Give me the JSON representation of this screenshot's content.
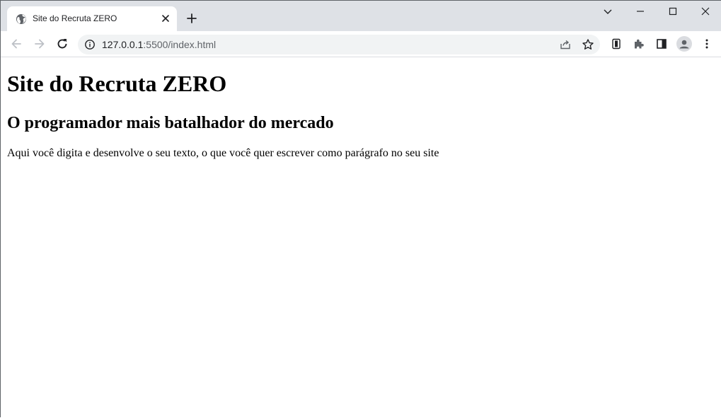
{
  "browser": {
    "tab": {
      "title": "Site do Recruta ZERO",
      "favicon": "globe-icon"
    },
    "address_bar": {
      "url_host": "127.0.0.1",
      "url_rest": ":5500/index.html"
    },
    "icons": {
      "back": "arrow-left-icon",
      "forward": "arrow-right-icon",
      "reload": "reload-icon",
      "site_info": "info-icon",
      "share": "share-icon",
      "bookmark": "star-icon",
      "extension_1": "extension-icon",
      "extensions": "puzzle-icon",
      "side_panel": "side-panel-icon",
      "profile": "avatar-icon",
      "menu": "more-vert-icon",
      "tab_search": "chevron-down-icon",
      "minimize": "minimize-icon",
      "maximize": "maximize-icon",
      "close": "close-icon",
      "new_tab": "plus-icon"
    }
  },
  "page": {
    "heading": "Site do Recruta ZERO",
    "subheading": "O programador mais batalhador do mercado",
    "paragraph": "Aqui você digita e desenvolve o seu texto, o que você quer escrever como parágrafo no seu site"
  },
  "colors": {
    "tabstrip_bg": "#dee1e6",
    "omnibox_bg": "#f1f3f4",
    "icon_gray": "#5f6368"
  }
}
